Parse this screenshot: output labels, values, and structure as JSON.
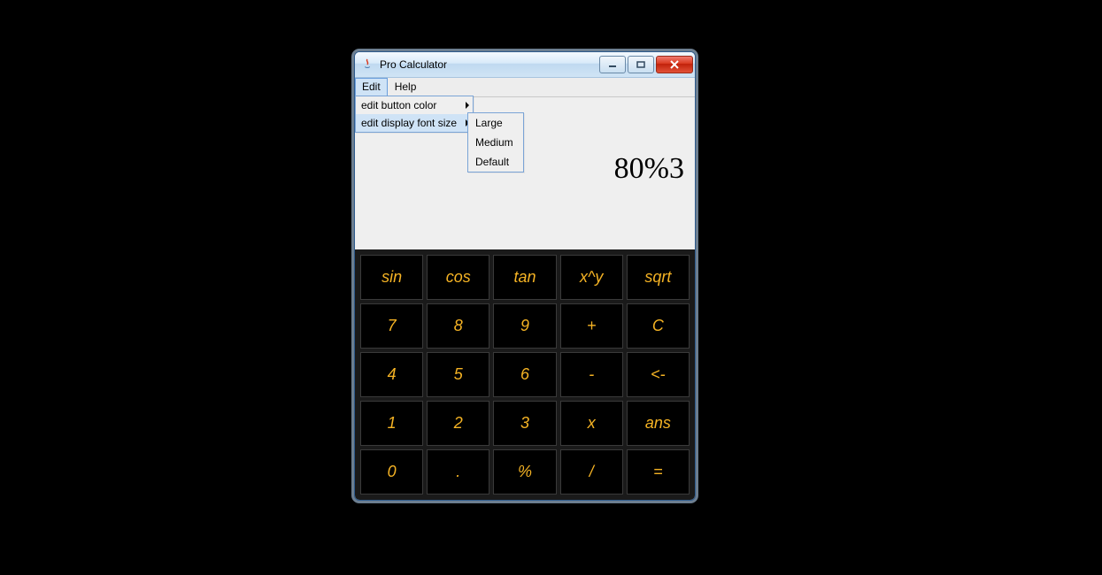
{
  "window": {
    "title": "Pro Calculator"
  },
  "menubar": {
    "edit": "Edit",
    "help": "Help"
  },
  "edit_menu": {
    "items": [
      {
        "label": "edit button color",
        "highlight": false
      },
      {
        "label": "edit display font size",
        "highlight": true
      }
    ]
  },
  "font_size_submenu": {
    "items": [
      {
        "label": "Large"
      },
      {
        "label": "Medium"
      },
      {
        "label": "Default"
      }
    ]
  },
  "display": {
    "value": "80%3"
  },
  "keypad": {
    "rows": [
      [
        "sin",
        "cos",
        "tan",
        "x^y",
        "sqrt"
      ],
      [
        "7",
        "8",
        "9",
        "+",
        "C"
      ],
      [
        "4",
        "5",
        "6",
        "-",
        "<-"
      ],
      [
        "1",
        "2",
        "3",
        "x",
        "ans"
      ],
      [
        "0",
        ".",
        "%",
        "/",
        "="
      ]
    ]
  },
  "colors": {
    "key_text": "#f5b324",
    "key_bg": "#000000",
    "accent": "#6a9edc"
  }
}
